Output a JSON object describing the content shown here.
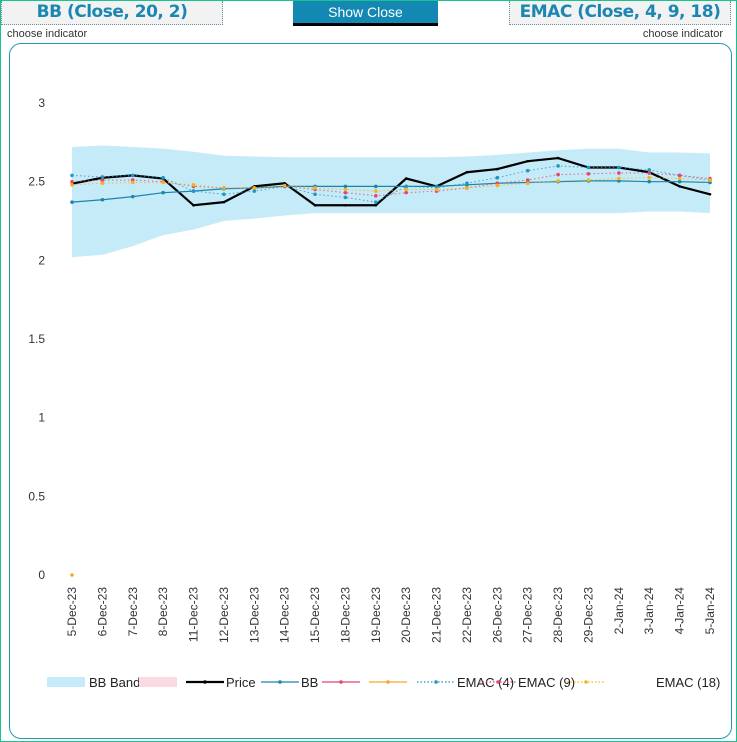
{
  "header": {
    "left_indicator": "BB (Close, 20, 2)",
    "left_hint": "choose indicator",
    "center_button": "Show Close",
    "right_indicator": "EMAC (Close, 4, 9, 18)",
    "right_hint": "choose indicator"
  },
  "chart_data": {
    "type": "line",
    "categories": [
      "5-Dec-23",
      "6-Dec-23",
      "7-Dec-23",
      "8-Dec-23",
      "11-Dec-23",
      "12-Dec-23",
      "13-Dec-23",
      "14-Dec-23",
      "15-Dec-23",
      "18-Dec-23",
      "19-Dec-23",
      "20-Dec-23",
      "21-Dec-23",
      "22-Dec-23",
      "26-Dec-23",
      "27-Dec-23",
      "28-Dec-23",
      "29-Dec-23",
      "2-Jan-24",
      "3-Jan-24",
      "4-Jan-24",
      "5-Jan-24"
    ],
    "ylim": [
      0,
      3
    ],
    "yticks": [
      "0",
      "0.5",
      "1",
      "1.5",
      "2",
      "2.5",
      "3"
    ],
    "grid": false,
    "legend_position": "bottom",
    "band": {
      "name": "BB Band",
      "color": "#c5ebf8",
      "upper": [
        2.72,
        2.73,
        2.72,
        2.71,
        2.69,
        2.665,
        2.66,
        2.655,
        2.655,
        2.655,
        2.655,
        2.655,
        2.655,
        2.66,
        2.67,
        2.685,
        2.7,
        2.71,
        2.71,
        2.685,
        2.685,
        2.68
      ],
      "lower": [
        2.02,
        2.035,
        2.09,
        2.16,
        2.195,
        2.25,
        2.265,
        2.285,
        2.3,
        2.3,
        2.3,
        2.3,
        2.3,
        2.3,
        2.3,
        2.3,
        2.3,
        2.3,
        2.3,
        2.31,
        2.31,
        2.3
      ]
    },
    "band2": {
      "name": "",
      "color": "#fadbe3"
    },
    "series": [
      {
        "name": "Price",
        "color": "#000000",
        "style": "solid",
        "width": 2.2,
        "values": [
          2.487,
          2.525,
          2.54,
          2.52,
          2.35,
          2.37,
          2.47,
          2.49,
          2.35,
          2.35,
          2.35,
          2.52,
          2.47,
          2.56,
          2.58,
          2.63,
          2.65,
          2.59,
          2.59,
          2.56,
          2.47,
          2.42
        ]
      },
      {
        "name": "BB",
        "color": "#1a85a8",
        "style": "solid",
        "width": 1.2,
        "values": [
          2.37,
          2.385,
          2.405,
          2.43,
          2.44,
          2.455,
          2.46,
          2.47,
          2.47,
          2.47,
          2.47,
          2.47,
          2.47,
          2.48,
          2.49,
          2.495,
          2.5,
          2.505,
          2.505,
          2.5,
          2.5,
          2.495
        ]
      },
      {
        "name": "",
        "color": "#e8456e",
        "style": "solid",
        "width": 1.2,
        "values": []
      },
      {
        "name": "",
        "color": "#f5a623",
        "style": "solid",
        "width": 1.2,
        "values": [
          0
        ]
      },
      {
        "name": "EMAC (4)",
        "color": "#2196c4",
        "style": "dotted",
        "width": 1,
        "values": [
          2.54,
          2.53,
          2.54,
          2.525,
          2.44,
          2.42,
          2.44,
          2.47,
          2.42,
          2.4,
          2.37,
          2.47,
          2.46,
          2.49,
          2.525,
          2.57,
          2.6,
          2.59,
          2.59,
          2.575,
          2.54,
          2.51
        ]
      },
      {
        "name": "EMAC (9)",
        "color": "#e8456e",
        "style": "dotted",
        "width": 1,
        "values": [
          2.5,
          2.51,
          2.51,
          2.5,
          2.47,
          2.46,
          2.46,
          2.47,
          2.45,
          2.43,
          2.41,
          2.43,
          2.44,
          2.46,
          2.49,
          2.51,
          2.545,
          2.55,
          2.555,
          2.555,
          2.54,
          2.52
        ]
      },
      {
        "name": "EMAC (18)",
        "color": "#f5b21a",
        "style": "dotted",
        "width": 1,
        "values": [
          2.48,
          2.49,
          2.495,
          2.495,
          2.48,
          2.46,
          2.46,
          2.475,
          2.46,
          2.45,
          2.44,
          2.45,
          2.45,
          2.46,
          2.475,
          2.49,
          2.505,
          2.51,
          2.52,
          2.525,
          2.52,
          2.51
        ]
      }
    ]
  }
}
